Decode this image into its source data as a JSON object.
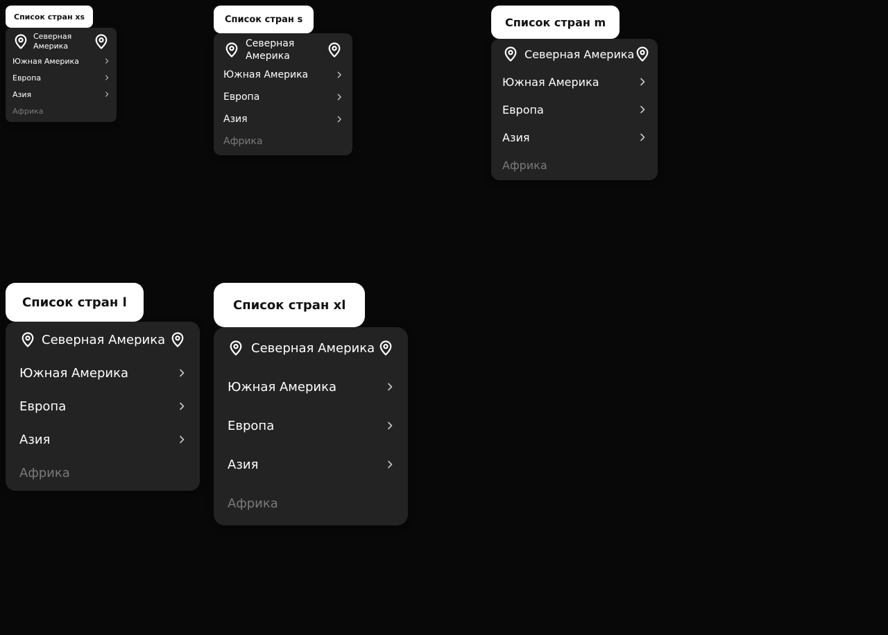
{
  "colors": {
    "background": "#080808",
    "menu_background": "#232323",
    "trigger_background": "#ffffff",
    "text": "#ffffff",
    "disabled_text": "#7a7a7a"
  },
  "variants": {
    "xs": {
      "trigger_label": "Список стран xs",
      "items": [
        {
          "label": "Северная Америка",
          "left_icon": "location-pin-icon",
          "right_icon": "location-pin-icon"
        },
        {
          "label": "Южная Америка",
          "right_icon": "chevron-right-icon"
        },
        {
          "label": "Европа",
          "right_icon": "chevron-right-icon"
        },
        {
          "label": "Азия",
          "right_icon": "chevron-right-icon"
        },
        {
          "label": "Африка",
          "disabled": true
        }
      ]
    },
    "s": {
      "trigger_label": "Список стран s",
      "items": [
        {
          "label": "Северная Америка",
          "left_icon": "location-pin-icon",
          "right_icon": "location-pin-icon"
        },
        {
          "label": "Южная Америка",
          "right_icon": "chevron-right-icon"
        },
        {
          "label": "Европа",
          "right_icon": "chevron-right-icon"
        },
        {
          "label": "Азия",
          "right_icon": "chevron-right-icon"
        },
        {
          "label": "Африка",
          "disabled": true
        }
      ]
    },
    "m": {
      "trigger_label": "Список стран m",
      "items": [
        {
          "label": "Северная Америка",
          "left_icon": "location-pin-icon",
          "right_icon": "location-pin-icon"
        },
        {
          "label": "Южная Америка",
          "right_icon": "chevron-right-icon"
        },
        {
          "label": "Европа",
          "right_icon": "chevron-right-icon"
        },
        {
          "label": "Азия",
          "right_icon": "chevron-right-icon"
        },
        {
          "label": "Африка",
          "disabled": true
        }
      ]
    },
    "l": {
      "trigger_label": "Список стран l",
      "items": [
        {
          "label": "Северная Америка",
          "left_icon": "location-pin-icon",
          "right_icon": "location-pin-icon"
        },
        {
          "label": "Южная Америка",
          "right_icon": "chevron-right-icon"
        },
        {
          "label": "Европа",
          "right_icon": "chevron-right-icon"
        },
        {
          "label": "Азия",
          "right_icon": "chevron-right-icon"
        },
        {
          "label": "Африка",
          "disabled": true
        }
      ]
    },
    "xl": {
      "trigger_label": "Список стран xl",
      "items": [
        {
          "label": "Северная Америка",
          "left_icon": "location-pin-icon",
          "right_icon": "location-pin-icon"
        },
        {
          "label": "Южная Америка",
          "right_icon": "chevron-right-icon"
        },
        {
          "label": "Европа",
          "right_icon": "chevron-right-icon"
        },
        {
          "label": "Азия",
          "right_icon": "chevron-right-icon"
        },
        {
          "label": "Африка",
          "disabled": true
        }
      ]
    }
  }
}
